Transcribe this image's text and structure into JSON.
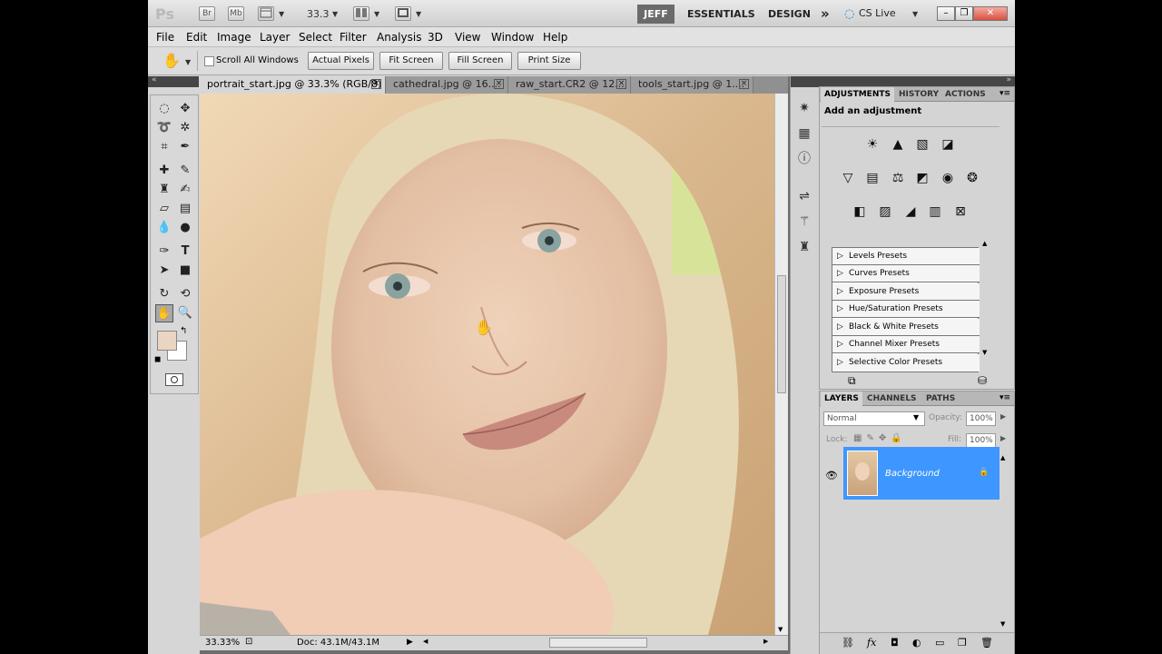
{
  "app": {
    "logo": "Ps",
    "bridge_label": "Br",
    "minibridge_label": "Mb",
    "zoom_value": "33.3",
    "workspaces": [
      "JEFF",
      "ESSENTIALS",
      "DESIGN"
    ],
    "more_glyph": "»",
    "cs_live": "CS Live",
    "window_buttons": [
      "–",
      "❐",
      "✕"
    ]
  },
  "menu": [
    "File",
    "Edit",
    "Image",
    "Layer",
    "Select",
    "Filter",
    "Analysis",
    "3D",
    "View",
    "Window",
    "Help"
  ],
  "options": {
    "scroll_all": "Scroll All Windows",
    "buttons": [
      "Actual Pixels",
      "Fit Screen",
      "Fill Screen",
      "Print Size"
    ]
  },
  "tabs": [
    {
      "label": "portrait_start.jpg @ 33.3% (RGB/8) *"
    },
    {
      "label": "cathedral.jpg @ 16...."
    },
    {
      "label": "raw_start.CR2 @ 12...."
    },
    {
      "label": "tools_start.jpg @ 1...."
    }
  ],
  "status": {
    "zoom": "33.33%",
    "doc": "Doc: 43.1M/43.1M"
  },
  "adjustments": {
    "tabs": [
      "ADJUSTMENTS",
      "HISTORY",
      "ACTIONS"
    ],
    "heading": "Add an adjustment",
    "presets": [
      "Levels Presets",
      "Curves Presets",
      "Exposure Presets",
      "Hue/Saturation Presets",
      "Black & White Presets",
      "Channel Mixer Presets",
      "Selective Color Presets"
    ]
  },
  "layers": {
    "tabs": [
      "LAYERS",
      "CHANNELS",
      "PATHS"
    ],
    "blend_mode": "Normal",
    "opacity_label": "Opacity:",
    "opacity_value": "100%",
    "lock_label": "Lock:",
    "fill_label": "Fill:",
    "fill_value": "100%",
    "layer_name": "Background"
  },
  "colors": {
    "foreground": "#ead5c2",
    "background": "#ffffff",
    "selection": "#3e96ff"
  }
}
